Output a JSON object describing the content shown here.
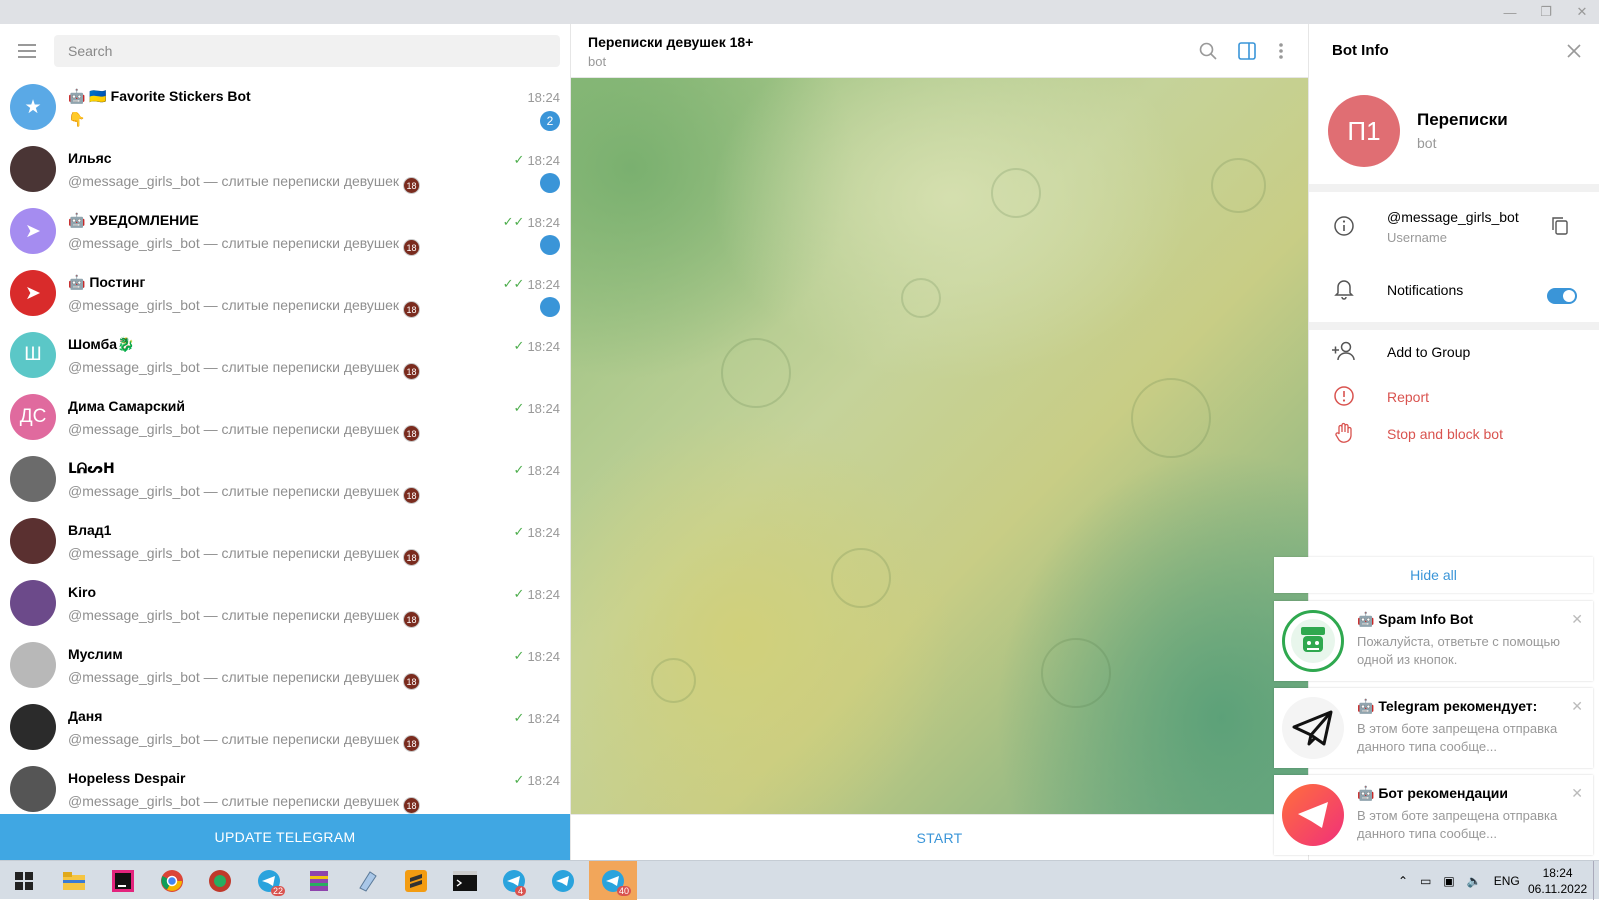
{
  "window": {
    "minimize": "—",
    "restore": "❐",
    "close": "✕"
  },
  "search": {
    "placeholder": "Search"
  },
  "chats": [
    {
      "name": "🤖 🇺🇦 Favorite Stickers Bot",
      "message": "👇",
      "time": "18:24",
      "check": "",
      "badge": "2",
      "avatar_text": "★",
      "avatar_color": "#5aa9e6",
      "show_18": false
    },
    {
      "name": "Ильяс",
      "message": "@message_girls_bot — слитые переписки девушек",
      "time": "18:24",
      "check": "✓",
      "badge": " ",
      "avatar_text": "",
      "avatar_color": "#4a3535",
      "show_18": true
    },
    {
      "name": "🤖 УВЕДОМЛЕНИЕ",
      "message": "@message_girls_bot — слитые переписки девушек",
      "time": "18:24",
      "check": "✓✓",
      "badge": " ",
      "avatar_text": "➤",
      "avatar_color": "#a58cf0",
      "show_18": true
    },
    {
      "name": "🤖 Постинг",
      "message": "@message_girls_bot — слитые переписки девушек",
      "time": "18:24",
      "check": "✓✓",
      "badge": " ",
      "avatar_text": "➤",
      "avatar_color": "#d92b2b",
      "show_18": true
    },
    {
      "name": "Шомба🐉",
      "message": "@message_girls_bot — слитые переписки девушек",
      "time": "18:24",
      "check": "✓",
      "badge": "",
      "avatar_text": "Ш",
      "avatar_color": "#5bc7c7",
      "show_18": true
    },
    {
      "name": "Дима Самарский",
      "message": "@message_girls_bot — слитые переписки девушек",
      "time": "18:24",
      "check": "✓",
      "badge": "",
      "avatar_text": "ДС",
      "avatar_color": "#e06a9e",
      "show_18": true
    },
    {
      "name": "ᒪᕱᔕᕼ",
      "message": "@message_girls_bot — слитые переписки девушек",
      "time": "18:24",
      "check": "✓",
      "badge": "",
      "avatar_text": "",
      "avatar_color": "#6b6b6b",
      "show_18": true
    },
    {
      "name": "Влад1",
      "message": "@message_girls_bot — слитые переписки девушек",
      "time": "18:24",
      "check": "✓",
      "badge": "",
      "avatar_text": "",
      "avatar_color": "#5a3030",
      "show_18": true
    },
    {
      "name": "Kiro",
      "message": "@message_girls_bot — слитые переписки девушек",
      "time": "18:24",
      "check": "✓",
      "badge": "",
      "avatar_text": "",
      "avatar_color": "#6c4a8a",
      "show_18": true
    },
    {
      "name": "Муслим",
      "message": "@message_girls_bot — слитые переписки девушек",
      "time": "18:24",
      "check": "✓",
      "badge": "",
      "avatar_text": "",
      "avatar_color": "#b8b8b8",
      "show_18": true
    },
    {
      "name": "Даня",
      "message": "@message_girls_bot — слитые переписки девушек",
      "time": "18:24",
      "check": "✓",
      "badge": "",
      "avatar_text": "",
      "avatar_color": "#2b2b2b",
      "show_18": true
    },
    {
      "name": "Hopeless Despair",
      "message": "@message_girls_bot — слитые переписки девушек",
      "time": "18:24",
      "check": "✓",
      "badge": "",
      "avatar_text": "",
      "avatar_color": "#555555",
      "show_18": true
    }
  ],
  "badge_18": "18",
  "update_label": "UPDATE TELEGRAM",
  "chat_header": {
    "title": "Переписки девушек 18+",
    "subtitle": "bot"
  },
  "start_label": "START",
  "bot_info": {
    "title": "Bot Info",
    "avatar_text": "П1",
    "name": "Переписки",
    "subtitle": "bot",
    "username": "@message_girls_bot",
    "username_label": "Username",
    "notifications_label": "Notifications",
    "notifications_on": true,
    "add_to_group": "Add to Group",
    "report": "Report",
    "stop_block": "Stop and block bot"
  },
  "notifications": {
    "hide_all": "Hide all",
    "items": [
      {
        "title": "🤖 Spam Info Bot",
        "text": "Пожалуйста, ответьте с помощью одной из кнопок."
      },
      {
        "title": "🤖 Telegram рекомендует:",
        "text": "В этом боте запрещена отправка данного типа сообще..."
      },
      {
        "title": "🤖 Бот рекомендации",
        "text": "В этом боте запрещена отправка данного типа сообще..."
      }
    ]
  },
  "taskbar": {
    "badges": {
      "telegram1": "22",
      "telegram2": "4",
      "telegram3": "40"
    },
    "lang": "ENG",
    "time": "18:24",
    "date": "06.11.2022"
  }
}
